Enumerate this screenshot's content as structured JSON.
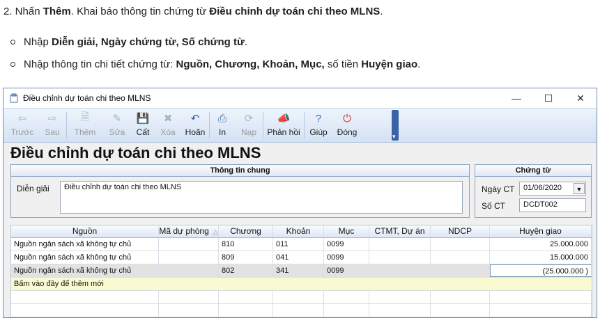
{
  "doc": {
    "step": {
      "prefix": "2. Nhấn ",
      "them": "Thêm",
      "mid": ". Khai báo thông tin chứng từ ",
      "target": "Điều chỉnh dự toán chi theo MLNS",
      "suffix": "."
    },
    "bullet1": {
      "prefix": "Nhập ",
      "bold": "Diễn giải, Ngày chứng từ, Số chứng từ",
      "suffix": "."
    },
    "bullet2": {
      "prefix": "Nhập thông tin chi tiết chứng từ: ",
      "bold": "Nguồn, Chương, Khoản, Mục,",
      "mid": " số tiền ",
      "bold2": "Huyện giao",
      "suffix": "."
    }
  },
  "window": {
    "title": "Điều chỉnh dự toán chi theo MLNS",
    "controls": {
      "minimize": "—",
      "maximize": "☐",
      "close": "✕"
    }
  },
  "toolbar": [
    {
      "id": "truoc",
      "label": "Trước",
      "icon": "arrow-left-icon",
      "glyph": "⇦",
      "enabled": false
    },
    {
      "id": "sau",
      "label": "Sau",
      "icon": "arrow-right-icon",
      "glyph": "⇨",
      "enabled": false
    },
    {
      "id": "them",
      "label": "Thêm",
      "icon": "add-doc-icon",
      "glyph": "🗎",
      "enabled": false
    },
    {
      "id": "sua",
      "label": "Sửa",
      "icon": "edit-doc-icon",
      "glyph": "✎",
      "enabled": false
    },
    {
      "id": "cat",
      "label": "Cất",
      "icon": "save-icon",
      "glyph": "💾",
      "enabled": true
    },
    {
      "id": "xoa",
      "label": "Xóa",
      "icon": "delete-doc-icon",
      "glyph": "✖",
      "enabled": false
    },
    {
      "id": "hoan",
      "label": "Hoãn",
      "icon": "undo-icon",
      "glyph": "↶",
      "enabled": true
    },
    {
      "id": "in",
      "label": "In",
      "icon": "print-icon",
      "glyph": "⎙",
      "enabled": true
    },
    {
      "id": "nap",
      "label": "Nạp",
      "icon": "reload-icon",
      "glyph": "⟳",
      "enabled": false
    },
    {
      "id": "phanhoi",
      "label": "Phản hồi",
      "icon": "megaphone-icon",
      "glyph": "📣",
      "enabled": true
    },
    {
      "id": "giup",
      "label": "Giúp",
      "icon": "help-icon",
      "glyph": "?",
      "enabled": true
    },
    {
      "id": "dong",
      "label": "Đóng",
      "icon": "close-form-icon",
      "glyph": "⏻",
      "enabled": true
    }
  ],
  "heading": "Điều chỉnh dự toán chi theo MLNS",
  "general": {
    "title": "Thông tin chung",
    "dien_giai_label": "Diễn giải",
    "dien_giai_value": "Điều chỉnh dự toán chi theo MLNS"
  },
  "voucher": {
    "title": "Chứng từ",
    "ngay_label": "Ngày CT",
    "ngay_value": "01/06/2020",
    "so_label": "Số CT",
    "so_value": "DCDT002"
  },
  "grid": {
    "columns": [
      "Nguồn",
      "Mã dự phòng",
      "Chương",
      "Khoản",
      "Mục",
      "CTMT, Dự án",
      "NDCP",
      "Huyện giao"
    ],
    "rows": [
      {
        "nguon": "Nguồn ngân sách xã không tự chủ",
        "ma_du_phong": "",
        "chuong": "810",
        "khoan": "011",
        "muc": "0099",
        "ctmt": "",
        "ndcp": "",
        "huyen_giao": "25.000.000"
      },
      {
        "nguon": "Nguồn ngân sách xã không tự chủ",
        "ma_du_phong": "",
        "chuong": "809",
        "khoan": "041",
        "muc": "0099",
        "ctmt": "",
        "ndcp": "",
        "huyen_giao": "15.000.000"
      },
      {
        "nguon": "Nguồn ngân sách xã không tự chủ",
        "ma_du_phong": "",
        "chuong": "802",
        "khoan": "341",
        "muc": "0099",
        "ctmt": "",
        "ndcp": "",
        "huyen_giao": "(25.000.000 )"
      }
    ],
    "new_row_text": "Bấm vào đây để thêm mới"
  }
}
